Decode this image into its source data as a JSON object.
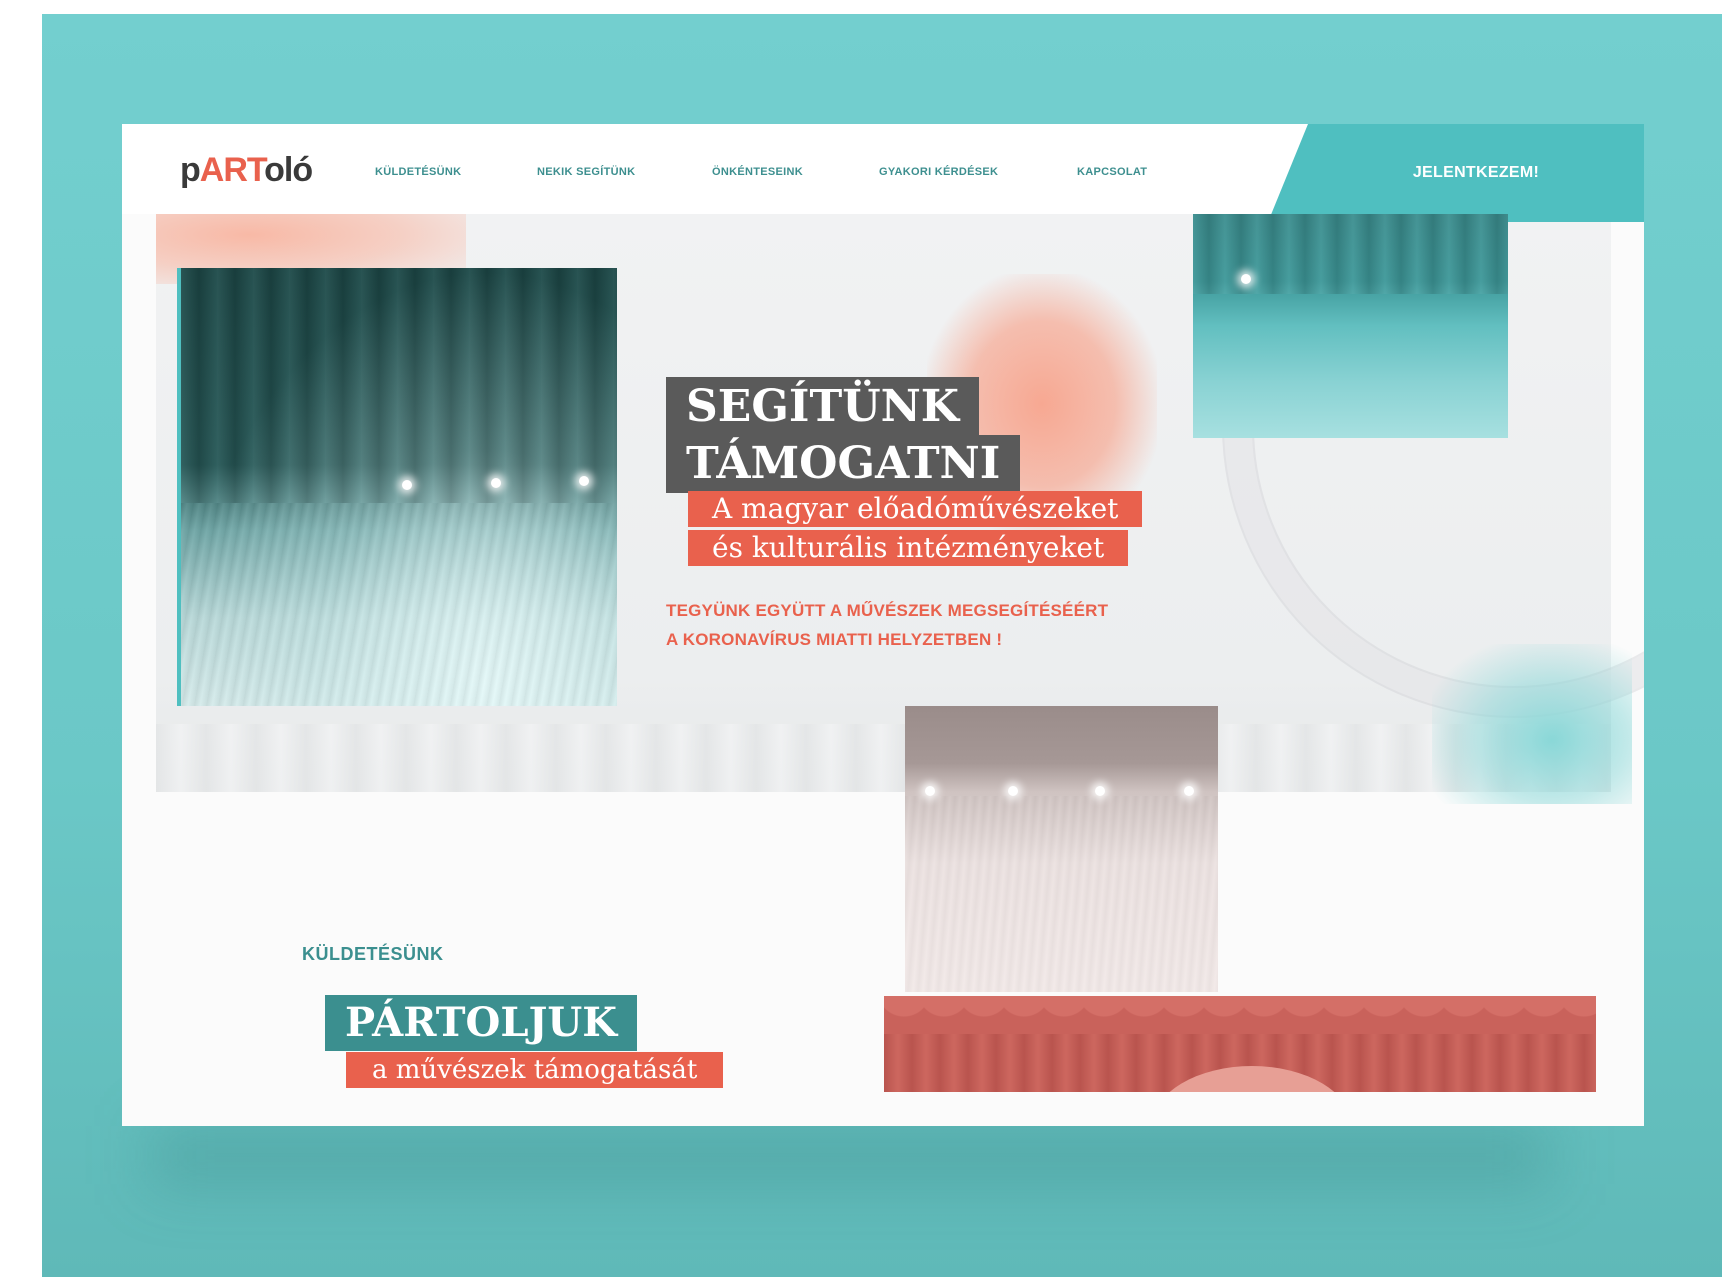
{
  "brand": {
    "logo_part1": "p",
    "logo_part2": "ART",
    "logo_part3": "oló",
    "accent_teal": "#4fbfc0",
    "accent_coral": "#e9614d"
  },
  "nav": {
    "items": [
      {
        "label": "KÜLDETÉSÜNK"
      },
      {
        "label": "NEKIK SEGÍTÜNK"
      },
      {
        "label": "ÖNKÉNTESEINK"
      },
      {
        "label": "GYAKORI KÉRDÉSEK"
      },
      {
        "label": "KAPCSOLAT"
      }
    ],
    "cta_label": "JELENTKEZEM!"
  },
  "hero": {
    "title_line1": "SEGÍTÜNK",
    "title_line2": "TÁMOGATNI",
    "sub_line1": "A magyar előadóművészeket",
    "sub_line2": "és kulturális intézményeket",
    "tagline_line1": "TEGYÜNK EGYÜTT A MŰVÉSZEK MEGSEGÍTÉSÉÉRT",
    "tagline_line2": "A KORONAVÍRUS MIATTI HELYZETBEN !"
  },
  "mission": {
    "label": "KÜLDETÉSÜNK",
    "title": "PÁRTOLJUK",
    "subtitle": "a művészek támogatását"
  }
}
